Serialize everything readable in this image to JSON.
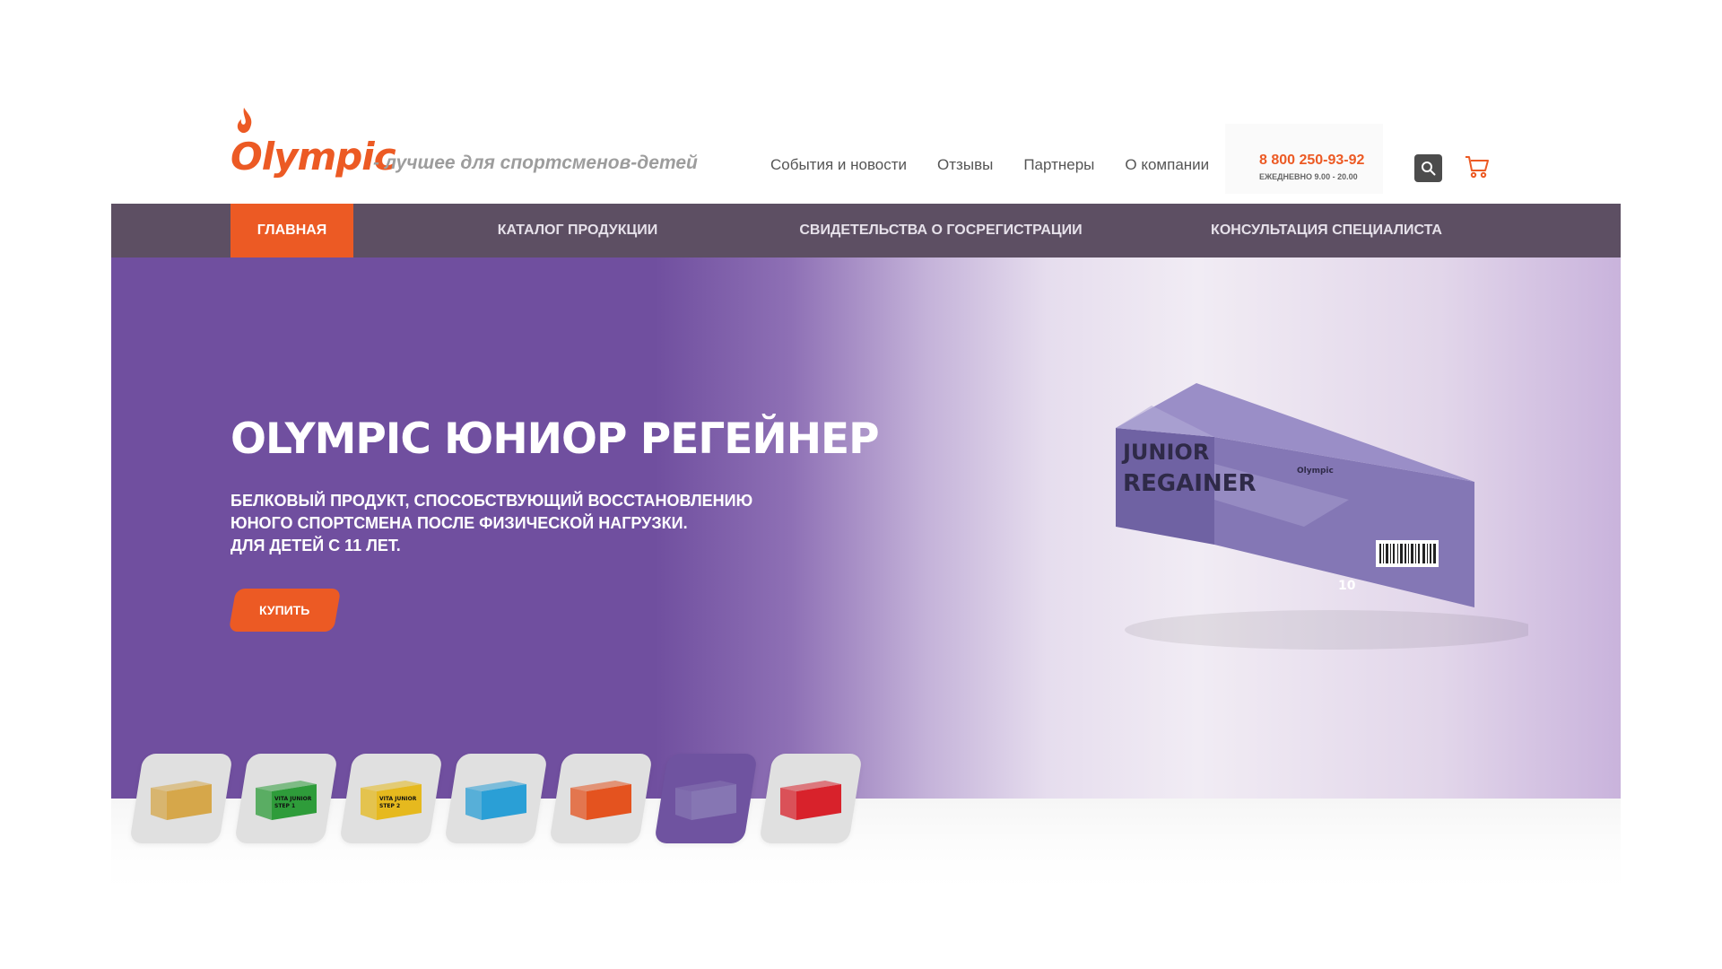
{
  "header": {
    "logo_text": "Olympic",
    "tagline": "- лучшее для спортсменов-детей",
    "nav": [
      "События и новости",
      "Отзывы",
      "Партнеры",
      "О компании"
    ],
    "phone": "8 800 250-93-92",
    "hours": "ЕЖЕДНЕВНО 9.00 - 20.00",
    "icons": {
      "search": "search-icon",
      "cart": "cart-icon"
    }
  },
  "main_menu": [
    "ГЛАВНАЯ",
    "КАТАЛОГ ПРОДУКЦИИ",
    "СВИДЕТЕЛЬСТВА О ГОСРЕГИСТРАЦИИ",
    "КОНСУЛЬТАЦИЯ СПЕЦИАЛИСТА"
  ],
  "hero": {
    "title": "OLYMPIC ЮНИОР РЕГЕЙНЕР",
    "description": [
      "БЕЛКОВЫЙ ПРОДУКТ, СПОСОБСТВУЮЩИЙ ВОССТАНОВЛЕНИЮ",
      "ЮНОГО СПОРТСМЕНА ПОСЛЕ ФИЗИЧЕСКОЙ НАГРУЗКИ.",
      "ДЛЯ ДЕТЕЙ С 11 ЛЕТ."
    ],
    "button": "КУПИТЬ",
    "box": {
      "line1": "JUNIOR",
      "line2": "REGAINER",
      "brand": "Olympic",
      "count": "10"
    }
  },
  "thumbnails": [
    {
      "name": "thumb-assorted",
      "color": "#d6a74a",
      "active": false
    },
    {
      "name": "thumb-vita-junior-step1",
      "color": "#2e9c3a",
      "label": "VITA JUNIOR",
      "sub": "STEP 1",
      "active": false
    },
    {
      "name": "thumb-vita-junior-step2",
      "color": "#e6b91e",
      "label": "VITA JUNIOR",
      "sub": "STEP 2",
      "active": false
    },
    {
      "name": "thumb-blue",
      "color": "#2a9fd6",
      "active": false
    },
    {
      "name": "thumb-orange",
      "color": "#e4531f",
      "active": false
    },
    {
      "name": "thumb-regainer",
      "color": "#8676b3",
      "active": true
    },
    {
      "name": "thumb-red",
      "color": "#d8222b",
      "active": false
    }
  ],
  "colors": {
    "accent": "#ec5a24",
    "menu_bg": "#5d4f63",
    "hero_purple": "#704f9f"
  }
}
